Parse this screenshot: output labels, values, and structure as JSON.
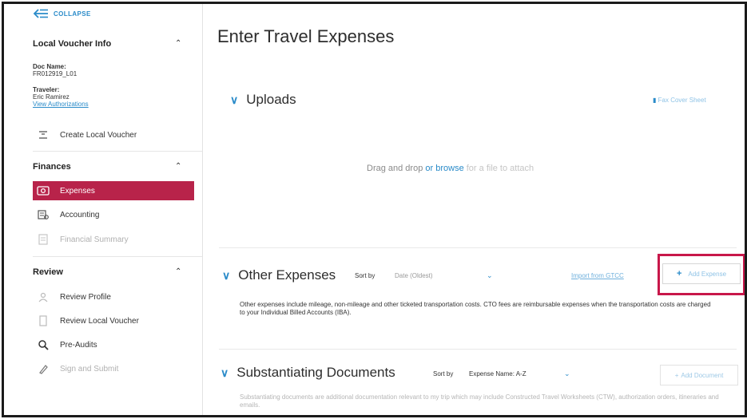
{
  "sidebar": {
    "collapse_label": "COLLAPSE",
    "voucher_info": {
      "heading": "Local Voucher Info",
      "doc_name_label": "Doc Name:",
      "doc_name_value": "FR012919_L01",
      "traveler_label": "Traveler:",
      "traveler_value": "Eric Ramirez",
      "view_link": "View Authorizations",
      "create_label": "Create Local Voucher"
    },
    "finances": {
      "heading": "Finances",
      "items": [
        {
          "label": "Expenses",
          "icon": "money-icon"
        },
        {
          "label": "Accounting",
          "icon": "accounting-icon"
        },
        {
          "label": "Financial Summary",
          "icon": "summary-icon"
        }
      ]
    },
    "review": {
      "heading": "Review",
      "items": [
        {
          "label": "Review Profile",
          "icon": "profile-icon"
        },
        {
          "label": "Review Local Voucher",
          "icon": "document-icon"
        },
        {
          "label": "Pre-Audits",
          "icon": "magnifier-icon"
        },
        {
          "label": "Sign and Submit",
          "icon": "sign-icon"
        }
      ]
    }
  },
  "main": {
    "title": "Enter Travel Expenses",
    "uploads": {
      "title": "Uploads",
      "cover_sheet": "Fax Cover Sheet",
      "drop_text": "Drag and drop",
      "drop_or_browse": "or browse",
      "drop_suffix": "for a file to attach"
    },
    "other_expenses": {
      "title": "Other Expenses",
      "sort_by": "Sort by",
      "sort_value": "Date (Oldest)",
      "import_link": "Import from GTCC",
      "add_button": "Add Expense",
      "description": "Other expenses include mileage, non-mileage and other ticketed transportation costs. CTO fees are reimbursable expenses when the transportation costs are charged to your Individual Billed Accounts (IBA)."
    },
    "substantiating": {
      "title": "Substantiating Documents",
      "sort_by": "Sort by",
      "sort_value": "Expense Name: A-Z",
      "add_button": "Add Document",
      "description": "Substantiating documents are additional documentation relevant to my trip which may include Constructed Travel Worksheets (CTW), authorization orders, itineraries and emails."
    }
  },
  "colors": {
    "accent": "#b8234a",
    "link": "#2a8bc9",
    "highlight": "#c8174a"
  }
}
